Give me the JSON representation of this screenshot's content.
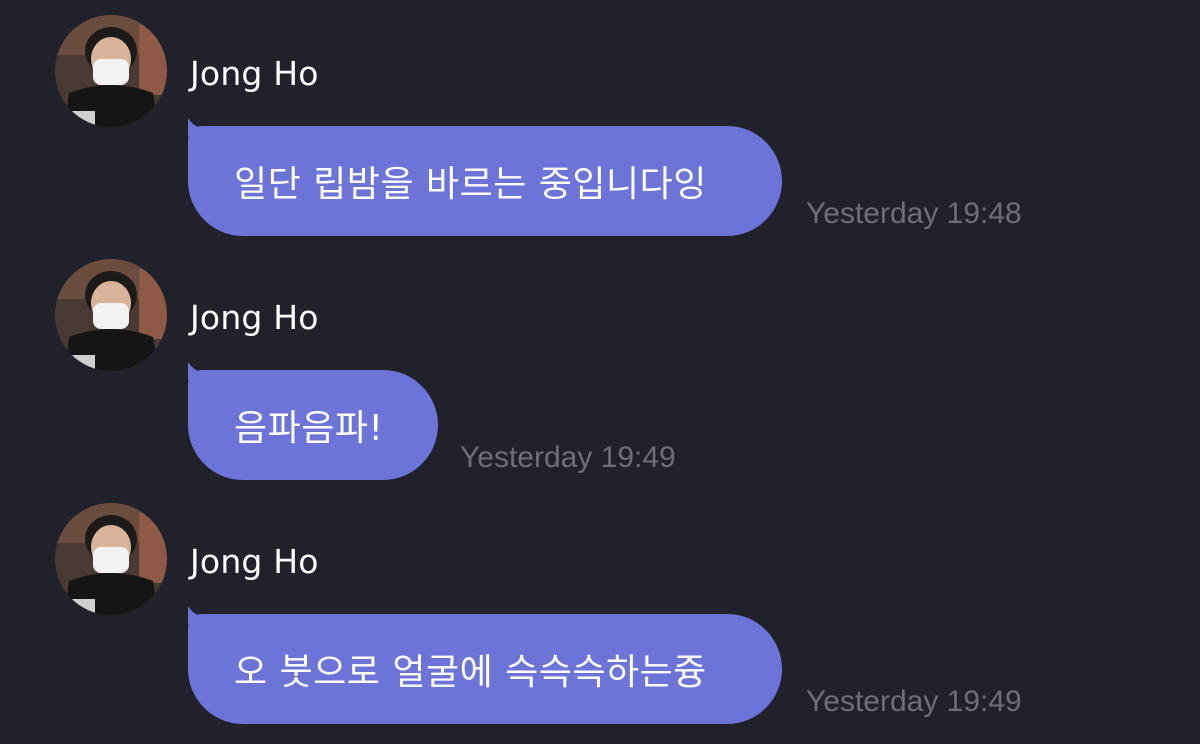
{
  "messages": [
    {
      "sender": "Jong Ho",
      "text": "일단 립밤을 바르는 중입니다잉",
      "time": "Yesterday 19:48"
    },
    {
      "sender": "Jong Ho",
      "text": "음파음파!",
      "time": "Yesterday 19:49"
    },
    {
      "sender": "Jong Ho",
      "text": "오 붓으로 얼굴에 슥슥슥하는즁",
      "time": "Yesterday 19:49"
    }
  ],
  "colors": {
    "background": "#20212b",
    "bubble": "#6c74d8",
    "timestamp": "#6d6e7c",
    "text": "#ffffff"
  },
  "icons": {
    "avatar": "profile-photo"
  }
}
